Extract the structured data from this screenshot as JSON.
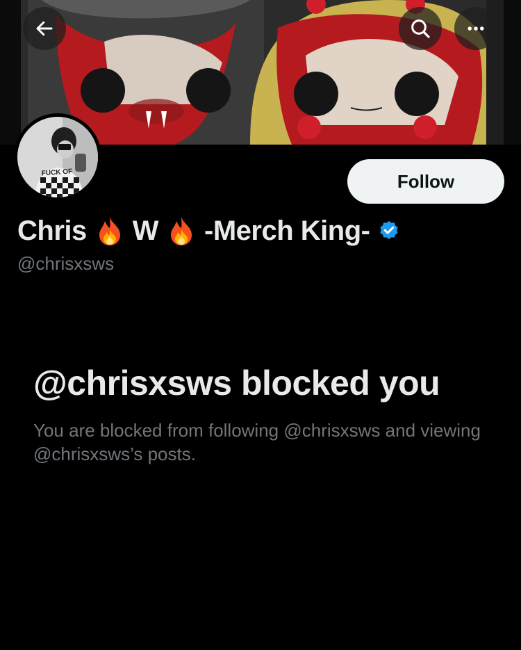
{
  "profile": {
    "name_part1": "Chris",
    "name_part2": "W",
    "name_part3": "-Merch King-",
    "name_emoji": "fire-emoji",
    "verified": true,
    "handle": "@chrisxsws",
    "avatar_overlay_text": "FUCK OF"
  },
  "actions": {
    "follow_label": "Follow"
  },
  "nav": {
    "back_icon": "arrow-left-icon",
    "search_icon": "search-icon",
    "more_icon": "more-horizontal-icon"
  },
  "blocked": {
    "title": "@chrisxsws blocked you",
    "description": "You are blocked from following @chrisxsws and viewing @chrisxsws’s posts."
  },
  "colors": {
    "background": "#000000",
    "primary_text": "#e7e9ea",
    "secondary_text": "#71767b",
    "follow_bg": "#eff3f4",
    "verified_blue": "#1d9bf0"
  }
}
